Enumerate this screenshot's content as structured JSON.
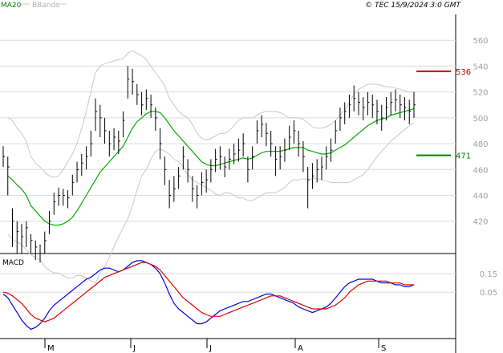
{
  "legend": {
    "ma": "MA20",
    "bbands": "BBands"
  },
  "copyright": "© TEC 15/9/2024 3:0 GMT",
  "macd_title": "MACD",
  "colors": {
    "ma": "#00aa00",
    "bb": "#c8c8c8",
    "bars": "#000000",
    "macd": "#0000dd",
    "signal": "#dd0000",
    "resistance": "#cc0000",
    "support": "#008000",
    "grid": "#dcdcdc"
  },
  "chart_data": [
    {
      "type": "ohlc",
      "name": "price",
      "y_range": [
        395,
        580
      ],
      "y_ticks": [
        "420",
        "440",
        "460",
        "480",
        "500",
        "520",
        "540",
        "560"
      ],
      "x_ticks": [
        "M",
        "J",
        "J",
        "A",
        "S"
      ],
      "close": [
        470,
        462,
        420,
        412,
        408,
        415,
        405,
        400,
        395,
        405,
        420,
        435,
        440,
        440,
        438,
        450,
        460,
        465,
        470,
        480,
        505,
        500,
        490,
        480,
        485,
        482,
        498,
        530,
        528,
        518,
        510,
        515,
        510,
        500,
        480,
        460,
        440,
        445,
        455,
        470,
        460,
        445,
        440,
        450,
        452,
        460,
        468,
        470,
        462,
        468,
        472,
        475,
        480,
        460,
        470,
        490,
        495,
        488,
        480,
        468,
        470,
        475,
        485,
        490,
        480,
        470,
        452,
        455,
        460,
        462,
        470,
        475,
        490,
        500,
        505,
        510,
        515,
        512,
        508,
        512,
        510,
        505,
        500,
        508,
        512,
        514,
        510,
        508,
        505,
        510
      ],
      "ranges": [
        [
          462,
          478
        ],
        [
          440,
          470
        ],
        [
          400,
          430
        ],
        [
          395,
          420
        ],
        [
          395,
          418
        ],
        [
          400,
          420
        ],
        [
          395,
          410
        ],
        [
          390,
          405
        ],
        [
          388,
          402
        ],
        [
          395,
          412
        ],
        [
          410,
          428
        ],
        [
          425,
          442
        ],
        [
          432,
          446
        ],
        [
          432,
          445
        ],
        [
          430,
          444
        ],
        [
          440,
          456
        ],
        [
          450,
          466
        ],
        [
          455,
          472
        ],
        [
          460,
          478
        ],
        [
          470,
          490
        ],
        [
          490,
          515
        ],
        [
          485,
          510
        ],
        [
          480,
          500
        ],
        [
          470,
          490
        ],
        [
          475,
          492
        ],
        [
          472,
          490
        ],
        [
          485,
          505
        ],
        [
          515,
          540
        ],
        [
          518,
          538
        ],
        [
          510,
          526
        ],
        [
          502,
          520
        ],
        [
          506,
          522
        ],
        [
          500,
          518
        ],
        [
          490,
          508
        ],
        [
          468,
          492
        ],
        [
          448,
          470
        ],
        [
          430,
          452
        ],
        [
          435,
          455
        ],
        [
          445,
          462
        ],
        [
          460,
          478
        ],
        [
          450,
          468
        ],
        [
          435,
          455
        ],
        [
          430,
          448
        ],
        [
          440,
          458
        ],
        [
          442,
          460
        ],
        [
          450,
          468
        ],
        [
          458,
          476
        ],
        [
          460,
          478
        ],
        [
          454,
          470
        ],
        [
          460,
          476
        ],
        [
          464,
          480
        ],
        [
          466,
          484
        ],
        [
          470,
          488
        ],
        [
          450,
          470
        ],
        [
          460,
          478
        ],
        [
          480,
          498
        ],
        [
          485,
          502
        ],
        [
          478,
          496
        ],
        [
          470,
          490
        ],
        [
          455,
          478
        ],
        [
          460,
          478
        ],
        [
          466,
          484
        ],
        [
          475,
          494
        ],
        [
          480,
          498
        ],
        [
          470,
          490
        ],
        [
          458,
          482
        ],
        [
          430,
          462
        ],
        [
          445,
          465
        ],
        [
          450,
          468
        ],
        [
          452,
          470
        ],
        [
          460,
          478
        ],
        [
          466,
          484
        ],
        [
          480,
          498
        ],
        [
          490,
          508
        ],
        [
          495,
          512
        ],
        [
          500,
          518
        ],
        [
          505,
          525
        ],
        [
          502,
          520
        ],
        [
          498,
          516
        ],
        [
          502,
          520
        ],
        [
          500,
          518
        ],
        [
          495,
          514
        ],
        [
          490,
          510
        ],
        [
          498,
          516
        ],
        [
          502,
          520
        ],
        [
          505,
          522
        ],
        [
          500,
          518
        ],
        [
          498,
          516
        ],
        [
          495,
          514
        ],
        [
          500,
          520
        ]
      ],
      "ma20": [
        null,
        455,
        452,
        448,
        445,
        440,
        432,
        428,
        424,
        420,
        418,
        417,
        417,
        418,
        420,
        423,
        428,
        434,
        440,
        446,
        452,
        458,
        462,
        466,
        470,
        474,
        478,
        485,
        492,
        497,
        500,
        503,
        505,
        505,
        504,
        500,
        495,
        490,
        486,
        482,
        478,
        474,
        470,
        466,
        464,
        463,
        463,
        464,
        465,
        466,
        467,
        468,
        469,
        468,
        469,
        471,
        473,
        474,
        474,
        474,
        474,
        475,
        476,
        477,
        477,
        477,
        475,
        474,
        473,
        472,
        472,
        473,
        475,
        477,
        479,
        482,
        485,
        488,
        491,
        494,
        496,
        498,
        499,
        500,
        502,
        503,
        504,
        505,
        506,
        507
      ],
      "bb_upper": [
        null,
        500,
        498,
        492,
        488,
        482,
        470,
        465,
        462,
        458,
        455,
        454,
        455,
        460,
        466,
        472,
        480,
        492,
        505,
        520,
        535,
        540,
        542,
        543,
        544,
        545,
        546,
        550,
        552,
        550,
        548,
        545,
        540,
        535,
        530,
        525,
        515,
        510,
        505,
        502,
        500,
        495,
        488,
        484,
        483,
        484,
        486,
        488,
        488,
        490,
        494,
        498,
        500,
        500,
        500,
        502,
        504,
        505,
        505,
        505,
        504,
        502,
        500,
        500,
        500,
        499,
        496,
        493,
        492,
        492,
        493,
        495,
        498,
        502,
        506,
        512,
        518,
        522,
        524,
        526,
        526,
        526,
        525,
        524,
        524,
        523,
        522,
        521,
        520,
        520
      ],
      "bb_lower": [
        null,
        410,
        406,
        404,
        402,
        398,
        394,
        392,
        390,
        385,
        382,
        380,
        380,
        378,
        376,
        376,
        378,
        378,
        376,
        374,
        372,
        380,
        385,
        392,
        400,
        408,
        415,
        422,
        432,
        444,
        455,
        460,
        468,
        474,
        476,
        474,
        472,
        468,
        466,
        462,
        456,
        452,
        450,
        448,
        446,
        444,
        441,
        440,
        442,
        442,
        440,
        438,
        438,
        436,
        436,
        438,
        440,
        442,
        442,
        442,
        444,
        446,
        450,
        452,
        452,
        453,
        452,
        453,
        453,
        452,
        451,
        450,
        450,
        450,
        450,
        450,
        452,
        454,
        456,
        460,
        465,
        470,
        474,
        478,
        482,
        485,
        488,
        491,
        494,
        496
      ],
      "levels": [
        {
          "label": "536",
          "value": 536,
          "kind": "resistance"
        },
        {
          "label": "471",
          "value": 471,
          "kind": "support"
        }
      ]
    },
    {
      "type": "line",
      "name": "macd",
      "y_range": [
        -0.2,
        0.25
      ],
      "y_ticks": [
        "0.05",
        "0.15"
      ],
      "macd": [
        0.04,
        0.02,
        -0.02,
        -0.06,
        -0.1,
        -0.13,
        -0.15,
        -0.14,
        -0.12,
        -0.09,
        -0.05,
        -0.02,
        0.0,
        0.02,
        0.04,
        0.06,
        0.08,
        0.1,
        0.12,
        0.13,
        0.15,
        0.17,
        0.18,
        0.18,
        0.17,
        0.16,
        0.17,
        0.19,
        0.21,
        0.22,
        0.22,
        0.21,
        0.2,
        0.18,
        0.15,
        0.1,
        0.04,
        -0.01,
        -0.04,
        -0.06,
        -0.08,
        -0.1,
        -0.12,
        -0.12,
        -0.11,
        -0.09,
        -0.07,
        -0.05,
        -0.04,
        -0.03,
        -0.02,
        -0.01,
        0.0,
        0.0,
        0.01,
        0.02,
        0.03,
        0.04,
        0.04,
        0.03,
        0.02,
        0.01,
        0.0,
        -0.01,
        -0.03,
        -0.04,
        -0.05,
        -0.06,
        -0.05,
        -0.04,
        -0.03,
        -0.01,
        0.02,
        0.05,
        0.08,
        0.1,
        0.11,
        0.12,
        0.12,
        0.12,
        0.12,
        0.11,
        0.1,
        0.1,
        0.1,
        0.09,
        0.09,
        0.08,
        0.08,
        0.09
      ],
      "signal": [
        0.05,
        0.045,
        0.03,
        0.01,
        -0.01,
        -0.04,
        -0.07,
        -0.09,
        -0.1,
        -0.11,
        -0.1,
        -0.09,
        -0.07,
        -0.05,
        -0.03,
        -0.01,
        0.01,
        0.03,
        0.05,
        0.07,
        0.09,
        0.11,
        0.13,
        0.14,
        0.15,
        0.16,
        0.17,
        0.18,
        0.19,
        0.2,
        0.21,
        0.21,
        0.2,
        0.19,
        0.17,
        0.14,
        0.11,
        0.08,
        0.05,
        0.02,
        0.0,
        -0.02,
        -0.04,
        -0.06,
        -0.07,
        -0.08,
        -0.08,
        -0.08,
        -0.07,
        -0.06,
        -0.05,
        -0.04,
        -0.03,
        -0.02,
        -0.01,
        0.0,
        0.01,
        0.02,
        0.03,
        0.03,
        0.03,
        0.02,
        0.01,
        0.0,
        -0.01,
        -0.02,
        -0.03,
        -0.04,
        -0.04,
        -0.04,
        -0.04,
        -0.03,
        -0.02,
        0.0,
        0.02,
        0.05,
        0.07,
        0.09,
        0.1,
        0.11,
        0.11,
        0.11,
        0.11,
        0.11,
        0.1,
        0.1,
        0.1,
        0.09,
        0.09,
        0.09
      ]
    }
  ]
}
